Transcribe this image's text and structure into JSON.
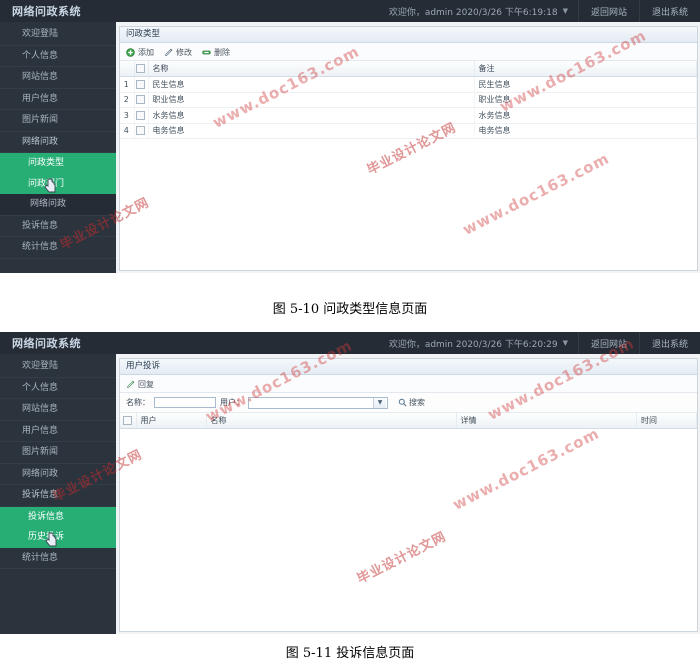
{
  "colors": {
    "sidebar_bg": "#2b333d",
    "topbar_bg": "#252c35",
    "accent_green": "#27ae75",
    "panel_border": "#ccd4dc",
    "watermark_red": "#c42e2e"
  },
  "screens": [
    {
      "id": "wenzheng-type-page",
      "header": {
        "brand": "网络问政系统",
        "welcome": "欢迎你，admin  2020/3/26 下午6:19:18",
        "caret": "▼",
        "buttons": [
          "返回网站",
          "退出系统"
        ]
      },
      "sidebar": {
        "items": [
          {
            "label": "欢迎登陆",
            "state": "normal"
          },
          {
            "label": "个人信息",
            "state": "normal"
          },
          {
            "label": "网站信息",
            "state": "normal"
          },
          {
            "label": "用户信息",
            "state": "normal"
          },
          {
            "label": "图片新闻",
            "state": "normal"
          },
          {
            "label": "网络问政",
            "state": "expanded"
          },
          {
            "label": "问政类型",
            "state": "sub-active"
          },
          {
            "label": "问政部门",
            "state": "sub-active-hover"
          },
          {
            "label": "网络问政",
            "state": "dark-sub"
          },
          {
            "label": "投诉信息",
            "state": "normal"
          },
          {
            "label": "统计信息",
            "state": "normal"
          }
        ]
      },
      "panel": {
        "title": "问政类型",
        "toolbar": [
          {
            "label": "添加",
            "icon": "plus-icon"
          },
          {
            "label": "修改",
            "icon": "pencil-icon"
          },
          {
            "label": "删除",
            "icon": "minus-icon"
          }
        ],
        "table": {
          "columns": [
            "",
            "",
            "名称",
            "备注"
          ],
          "rows": [
            {
              "index": "1",
              "name": "民生信息",
              "remark": "民生信息"
            },
            {
              "index": "2",
              "name": "职业信息",
              "remark": "职业信息"
            },
            {
              "index": "3",
              "name": "水务信息",
              "remark": "水务信息"
            },
            {
              "index": "4",
              "name": "电务信息",
              "remark": "电务信息"
            }
          ]
        }
      },
      "caption": "图 5-10 问政类型信息页面"
    },
    {
      "id": "complaint-info-page",
      "header": {
        "brand": "网络问政系统",
        "welcome": "欢迎你，admin  2020/3/26 下午6:20:29",
        "caret": "▼",
        "buttons": [
          "返回网站",
          "退出系统"
        ]
      },
      "sidebar": {
        "items": [
          {
            "label": "欢迎登陆",
            "state": "normal"
          },
          {
            "label": "个人信息",
            "state": "normal"
          },
          {
            "label": "网站信息",
            "state": "normal"
          },
          {
            "label": "用户信息",
            "state": "normal"
          },
          {
            "label": "图片新闻",
            "state": "normal"
          },
          {
            "label": "网络问政",
            "state": "normal"
          },
          {
            "label": "投诉信息",
            "state": "expanded"
          },
          {
            "label": "投诉信息",
            "state": "sub-active"
          },
          {
            "label": "历史投诉",
            "state": "sub-active-hover"
          },
          {
            "label": "统计信息",
            "state": "normal"
          }
        ]
      },
      "panel": {
        "title": "用户投诉",
        "toolbar": [
          {
            "label": "回复",
            "icon": "pencil-icon"
          }
        ],
        "search": {
          "name_label": "名称：",
          "name_value": "",
          "name_placeholder": "",
          "user_label": "用户：",
          "user_value": "",
          "user_arrow": "▼",
          "search_label": "搜索",
          "search_icon": "magnifier-icon"
        },
        "table": {
          "columns": [
            "",
            "用户",
            "名称",
            "详情",
            "时间"
          ],
          "rows": []
        }
      },
      "caption": "图 5-11 投诉信息页面"
    }
  ],
  "watermarks": [
    "www.doc163.com",
    "毕业设计论文网"
  ]
}
